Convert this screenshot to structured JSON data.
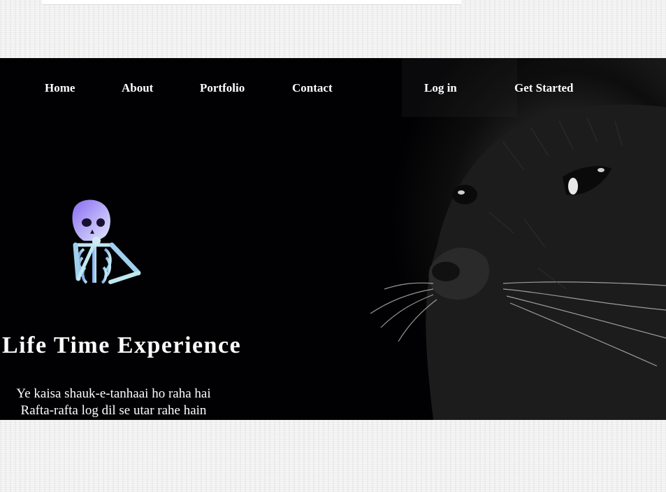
{
  "nav": {
    "links": [
      {
        "label": "Home"
      },
      {
        "label": "About"
      },
      {
        "label": "Portfolio"
      },
      {
        "label": "Contact"
      }
    ],
    "login_label": "Log in",
    "cta_label": "Get Started"
  },
  "hero": {
    "title": "Life Time Experience",
    "poem_line_1": "Ye kaisa shauk-e-tanhaai ho raha hai",
    "poem_line_2": "Rafta-rafta log dil se utar rahe hain"
  },
  "images": {
    "mascot": "thinking-skeleton-icon",
    "background": "black-cat-photo"
  },
  "colors": {
    "hero_background": "#010103",
    "text": "#ffffff",
    "page_texture": "#f6f6f6"
  }
}
